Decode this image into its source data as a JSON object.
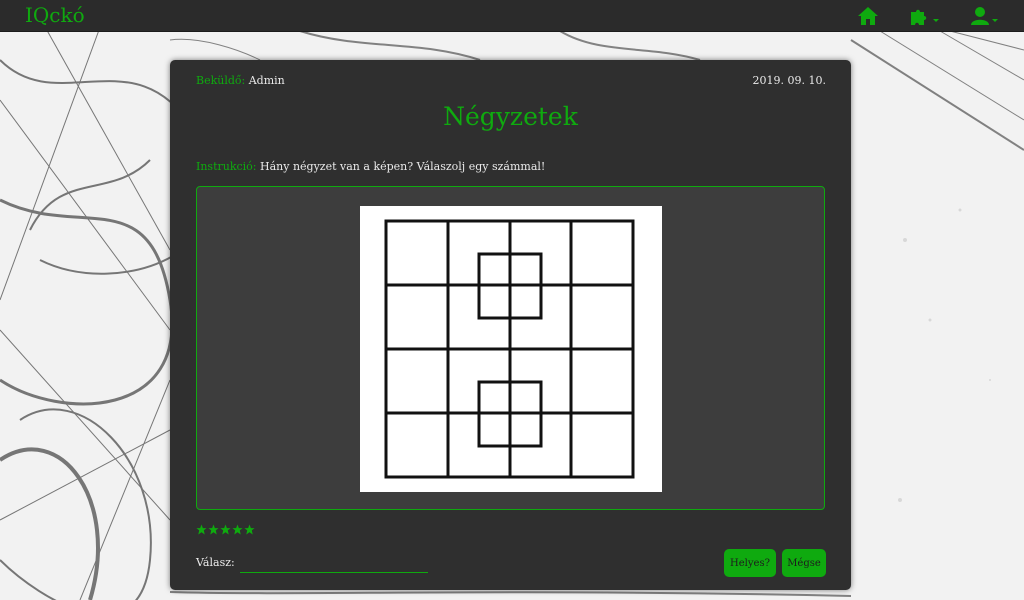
{
  "brand": "IQckó",
  "nav": {
    "icons": [
      "home-icon",
      "puzzle-icon",
      "user-icon"
    ]
  },
  "puzzle": {
    "submitter_label": "Beküldő:",
    "submitter": "Admin",
    "date": "2019. 09. 10.",
    "title": "Négyzetek",
    "instruction_label": "Instrukció:",
    "instruction": "Hány négyzet van a képen? Válaszolj egy számmal!",
    "rating": 5,
    "answer_label": "Válasz:",
    "answer_value": "",
    "check_button": "Helyes?",
    "cancel_button": "Mégse"
  },
  "colors": {
    "accent": "#0faa0f",
    "card": "#2f2f2f",
    "navbar": "#2b2b2b"
  }
}
